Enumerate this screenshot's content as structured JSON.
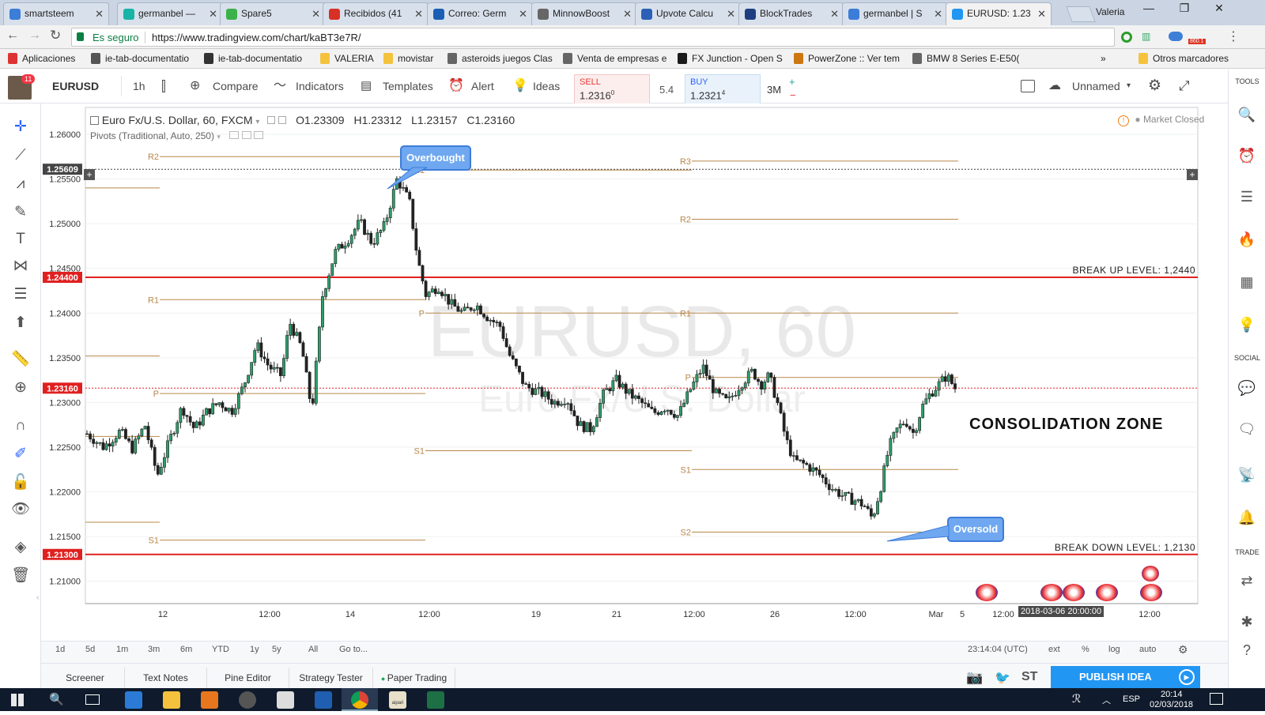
{
  "browser": {
    "tabs": [
      {
        "label": "smartsteem",
        "color": "#3b7dd8"
      },
      {
        "label": "germanbel —",
        "color": "#18b4a6"
      },
      {
        "label": "Spare5",
        "color": "#3bb14a"
      },
      {
        "label": "Recibidos (41",
        "color": "#d93025"
      },
      {
        "label": "Correo: Germ",
        "color": "#1a5fb4"
      },
      {
        "label": "MinnowBoost",
        "color": "#666666"
      },
      {
        "label": "Upvote Calcu",
        "color": "#2c5fb8"
      },
      {
        "label": "BlockTrades",
        "color": "#1d3f80"
      },
      {
        "label": "germanbel | S",
        "color": "#3b7dd8"
      },
      {
        "label": "EURUSD: 1.23",
        "color": "#2196f3"
      }
    ],
    "profile": "Valeria",
    "secure_label": "Es seguro",
    "url": "https://www.tradingview.com/chart/kaBT3e7R/",
    "bookmarks": [
      {
        "label": "Aplicaciones"
      },
      {
        "label": "ie-tab-documentatio"
      },
      {
        "label": "ie-tab-documentatio"
      },
      {
        "label": "VALERIA"
      },
      {
        "label": "movistar"
      },
      {
        "label": "asteroids juegos Clas"
      },
      {
        "label": "Venta de empresas e"
      },
      {
        "label": "FX Junction - Open S"
      },
      {
        "label": "PowerZone :: Ver tem"
      },
      {
        "label": "BMW 8 Series E-E50("
      },
      {
        "label": "Otros marcadores"
      }
    ],
    "more_bookmarks": "»",
    "ext_badge": "860.1"
  },
  "toolbar": {
    "symbol": "EURUSD",
    "interval": "1h",
    "compare": "Compare",
    "indicators": "Indicators",
    "templates": "Templates",
    "alert": "Alert",
    "ideas": "Ideas",
    "notif_count": "11",
    "sell_label": "SELL",
    "sell_price": "1.2316",
    "sell_sup": "0",
    "spread": "5.4",
    "buy_label": "BUY",
    "buy_price": "1.2321",
    "buy_sup": "4",
    "qty": "3M",
    "plus": "+",
    "minus": "−",
    "layout_name": "Unnamed"
  },
  "right_toolbar": {
    "tools": "TOOLS",
    "social": "SOCIAL",
    "trade": "TRADE"
  },
  "chart_header": {
    "title": "Euro Fx/U.S. Dollar, 60, FXCM",
    "o": "O1.23309",
    "h": "H1.23312",
    "l": "L1.23157",
    "c": "C1.23160",
    "indicator": "Pivots (Traditional, Auto, 250)",
    "market_status": "Market Closed"
  },
  "watermark": {
    "line1": "EURUSD, 60",
    "line2": "Euro Fx/U.S. Dollar"
  },
  "chart_data": {
    "type": "candlestick",
    "ylim": [
      1.2075,
      1.263
    ],
    "y_ticks": [
      "1.26000",
      "1.25500",
      "1.25000",
      "1.24500",
      "1.24000",
      "1.23500",
      "1.23000",
      "1.22500",
      "1.22000",
      "1.21500",
      "1.21000"
    ],
    "x_ticks": [
      "12",
      "12:00",
      "14",
      "12:00",
      "19",
      "21",
      "12:00",
      "26",
      "12:00",
      "Mar",
      "12:00",
      "5",
      "12:00"
    ],
    "price_labels": [
      {
        "text": "1.25609",
        "value": 1.25609,
        "color": "#444444"
      },
      {
        "text": "1.24400",
        "value": 1.244,
        "color": "#e02020"
      },
      {
        "text": "1.23160",
        "value": 1.2316,
        "color": "#e02020"
      },
      {
        "text": "1.21300",
        "value": 1.213,
        "color": "#e02020"
      }
    ],
    "horizontal_levels": [
      {
        "label": "BREAK UP LEVEL: 1,2440",
        "value": 1.244,
        "color": "#e02020"
      },
      {
        "label": "BREAK DOWN LEVEL: 1,2130",
        "value": 1.213,
        "color": "#e02020"
      }
    ],
    "pivot_lines": [
      {
        "label": "",
        "value": 1.254,
        "period": 0
      },
      {
        "label": "",
        "value": 1.2352,
        "period": 0
      },
      {
        "label": "",
        "value": 1.2262,
        "period": 0
      },
      {
        "label": "",
        "value": 1.2166,
        "period": 0
      },
      {
        "label": "R2",
        "value": 1.2575,
        "period": 1
      },
      {
        "label": "R1",
        "value": 1.2415,
        "period": 1
      },
      {
        "label": "P",
        "value": 1.231,
        "period": 1
      },
      {
        "label": "S1",
        "value": 1.2146,
        "period": 1
      },
      {
        "label": "R1",
        "value": 1.256,
        "period": 2
      },
      {
        "label": "P",
        "value": 1.24,
        "period": 2
      },
      {
        "label": "S1",
        "value": 1.2246,
        "period": 2
      },
      {
        "label": "R3",
        "value": 1.257,
        "period": 3
      },
      {
        "label": "R2",
        "value": 1.2505,
        "period": 3
      },
      {
        "label": "R1",
        "value": 1.24,
        "period": 3
      },
      {
        "label": "P",
        "value": 1.2328,
        "period": 3
      },
      {
        "label": "S1",
        "value": 1.2225,
        "period": 3
      },
      {
        "label": "S2",
        "value": 1.2155,
        "period": 3
      }
    ],
    "close_path": [
      [
        0,
        1.2265
      ],
      [
        0.02,
        1.225
      ],
      [
        0.04,
        1.2268
      ],
      [
        0.055,
        1.2248
      ],
      [
        0.07,
        1.2275
      ],
      [
        0.085,
        1.2218
      ],
      [
        0.1,
        1.2258
      ],
      [
        0.115,
        1.2295
      ],
      [
        0.13,
        1.227
      ],
      [
        0.145,
        1.229
      ],
      [
        0.16,
        1.23
      ],
      [
        0.175,
        1.229
      ],
      [
        0.19,
        1.232
      ],
      [
        0.205,
        1.2365
      ],
      [
        0.22,
        1.234
      ],
      [
        0.235,
        1.233
      ],
      [
        0.245,
        1.239
      ],
      [
        0.26,
        1.236
      ],
      [
        0.272,
        1.229
      ],
      [
        0.285,
        1.242
      ],
      [
        0.3,
        1.2468
      ],
      [
        0.315,
        1.2482
      ],
      [
        0.33,
        1.2502
      ],
      [
        0.345,
        1.2478
      ],
      [
        0.36,
        1.2498
      ],
      [
        0.375,
        1.255
      ],
      [
        0.39,
        1.2525
      ],
      [
        0.4,
        1.246
      ],
      [
        0.41,
        1.242
      ],
      [
        0.425,
        1.243
      ],
      [
        0.44,
        1.241
      ],
      [
        0.455,
        1.24
      ],
      [
        0.47,
        1.241
      ],
      [
        0.485,
        1.2395
      ],
      [
        0.5,
        1.2385
      ],
      [
        0.51,
        1.2355
      ],
      [
        0.53,
        1.2318
      ],
      [
        0.55,
        1.231
      ],
      [
        0.565,
        1.23
      ],
      [
        0.58,
        1.2305
      ],
      [
        0.595,
        1.2275
      ],
      [
        0.61,
        1.227
      ],
      [
        0.625,
        1.231
      ],
      [
        0.64,
        1.2325
      ],
      [
        0.655,
        1.231
      ],
      [
        0.67,
        1.23
      ],
      [
        0.685,
        1.2288
      ],
      [
        0.7,
        1.2295
      ],
      [
        0.715,
        1.2285
      ],
      [
        0.73,
        1.2315
      ],
      [
        0.745,
        1.234
      ],
      [
        0.76,
        1.231
      ],
      [
        0.775,
        1.23
      ],
      [
        0.79,
        1.232
      ],
      [
        0.805,
        1.2335
      ],
      [
        0.815,
        1.232
      ],
      [
        0.825,
        1.233
      ],
      [
        0.835,
        1.23
      ],
      [
        0.845,
        1.226
      ],
      [
        0.855,
        1.2235
      ],
      [
        0.87,
        1.223
      ],
      [
        0.885,
        1.222
      ],
      [
        0.9,
        1.2205
      ],
      [
        0.915,
        1.2195
      ],
      [
        0.93,
        1.219
      ],
      [
        0.94,
        1.2185
      ],
      [
        0.95,
        1.217
      ],
      [
        0.96,
        1.2205
      ],
      [
        0.97,
        1.225
      ],
      [
        0.98,
        1.227
      ],
      [
        0.99,
        1.228
      ],
      [
        1.0,
        1.2265
      ],
      [
        1.01,
        1.2295
      ],
      [
        1.02,
        1.231
      ],
      [
        1.03,
        1.232
      ],
      [
        1.04,
        1.233
      ],
      [
        1.05,
        1.2316
      ]
    ],
    "timestamp_label": "2018-03-06 20:00:00"
  },
  "annotations": {
    "overbought": "Overbought",
    "oversold": "Oversold",
    "consolidation": "CONSOLIDATION ZONE"
  },
  "date_ranges": [
    "1d",
    "5d",
    "1m",
    "3m",
    "6m",
    "YTD",
    "1y",
    "5y",
    "All",
    "Go to..."
  ],
  "footer_right": {
    "time": "23:14:04 (UTC)",
    "ext": "ext",
    "pct": "%",
    "log": "log",
    "auto": "auto"
  },
  "panels": [
    "Screener",
    "Text Notes",
    "Pine Editor",
    "Strategy Tester",
    "Paper Trading"
  ],
  "publish": "PUBLISH IDEA",
  "st_label": "ST",
  "taskbar": {
    "lang": "ESP",
    "time": "20:14",
    "date": "02/03/2018",
    "app_label": "aipari"
  }
}
